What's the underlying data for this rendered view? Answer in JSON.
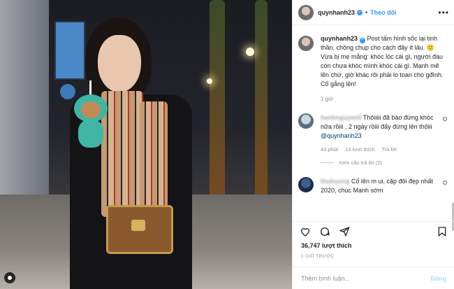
{
  "post": {
    "username": "quynhanh23",
    "follow_label": "Theo dõi",
    "separator": "•",
    "more_glyph": "•••",
    "verified_glyph": "✓"
  },
  "caption": {
    "username": "quynhanh23",
    "text": " Post tấm hình sốc lại tinh thần, chồng chụp cho cách đây ít lâu. 🙂 Vừa bị mẹ mắng: khóc lóc cái gì, người đau còn chưa khóc mình khóc cái gì. Mạnh mẽ lên chứ, giờ khác rồi phải lo toan cho gđình. Cố gắng lên!",
    "time": "1 giờ"
  },
  "comments": [
    {
      "username": "hanhnguyen0",
      "text": " Thôiiiii đã bảo đừng khóc nữa rồiii , 2 ngày rồiii đấy đứng lên thôiii ",
      "mention": "@quynhanh23",
      "time": "43 phút",
      "likes": "13 lượt thích",
      "reply": "Trả lời",
      "view_replies": "Xem câu trả lời (2)"
    },
    {
      "username": "thuhuong",
      "text": " Cố lên m ui, cặp đôi đẹp nhất 2020, chúc Manh sớm"
    }
  ],
  "actions": {
    "likes": "36,747 lượt thích",
    "time_ago": "1 GIỜ TRƯỚC"
  },
  "add_comment": {
    "placeholder": "Thêm bình luận...",
    "post_label": "Đăng"
  },
  "colors": {
    "accent": "#3897f0",
    "text": "#262626",
    "muted": "#8e8e8e"
  },
  "icons": [
    "heart-icon",
    "comment-icon",
    "share-icon",
    "bookmark-icon",
    "more-icon",
    "verified-icon"
  ]
}
